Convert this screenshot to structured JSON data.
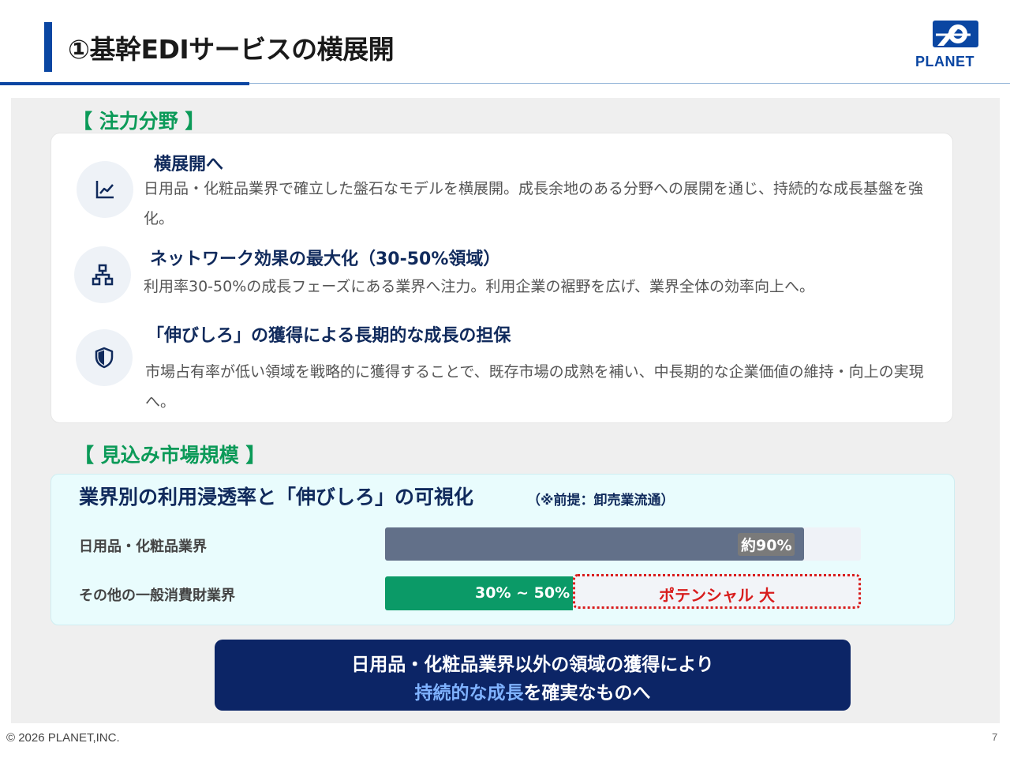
{
  "header": {
    "title": "①基幹EDIサービスの横展開",
    "logo_text": "PLANET"
  },
  "focus": {
    "label": "【 注力分野 】",
    "items": [
      {
        "icon": "chart-line-icon",
        "title": "横展開へ",
        "desc": "日用品・化粧品業界で確立した盤石なモデルを横展開。成長余地のある分野への展開を通じ、持続的な成長基盤を強化。"
      },
      {
        "icon": "network-icon",
        "title": "ネットワーク効果の最大化（30-50%領域）",
        "desc": "利用率30-50%の成長フェーズにある業界へ注力。利用企業の裾野を広げ、業界全体の効率向上へ。"
      },
      {
        "icon": "shield-icon",
        "title": "「伸びしろ」の獲得による長期的な成長の担保",
        "desc": "市場占有率が低い領域を戦略的に獲得することで、既存市場の成熟を補い、中長期的な企業価値の維持・向上の実現へ。"
      }
    ]
  },
  "market": {
    "label": "【 見込み市場規模 】",
    "title": "業界別の利用浸透率と「伸びしろ」の可視化",
    "note": "（※前提：卸売業流通）",
    "rows": [
      {
        "label": "日用品・化粧品業界",
        "value_label": "約90%",
        "value": 0.9
      },
      {
        "label": "その他の一般消費財業界",
        "value_label": "30% ~ 50%",
        "value": 0.4,
        "potential": "ポテンシャル 大"
      }
    ],
    "colors": {
      "bar1": "#627089",
      "bar2": "#0b9a67",
      "potential": "#d81d1d"
    }
  },
  "conclusion": {
    "line1": "日用品・化粧品業界以外の領域の獲得により",
    "line2_highlight": "持続的な成長",
    "line2_rest": "を確実なものへ"
  },
  "footer": {
    "copyright": "© 2026 PLANET,INC.",
    "page": "7"
  }
}
